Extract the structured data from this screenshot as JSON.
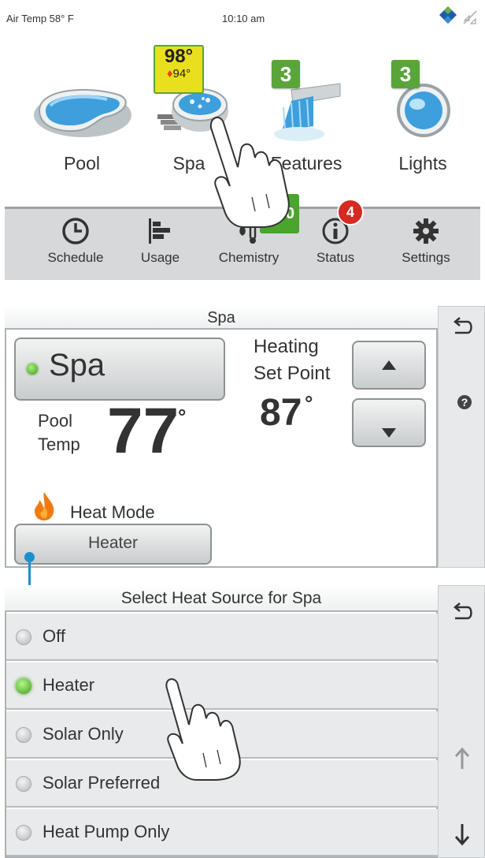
{
  "status_bar": {
    "air_temp": "Air Temp 58° F",
    "time": "10:10 am"
  },
  "tiles": [
    {
      "label": "Pool"
    },
    {
      "label": "Spa",
      "temp": "98°",
      "set": "94°"
    },
    {
      "label": "Features",
      "badge": "3"
    },
    {
      "label": "Lights",
      "badge": "3"
    }
  ],
  "nav": [
    {
      "label": "Schedule",
      "icon": "clock-icon"
    },
    {
      "label": "Usage",
      "icon": "bar-chart-icon"
    },
    {
      "label": "Chemistry",
      "icon": "drop-thermometer-icon",
      "badge": "0"
    },
    {
      "label": "Status",
      "icon": "info-icon",
      "badge": "4"
    },
    {
      "label": "Settings",
      "icon": "gear-icon"
    }
  ],
  "spa_panel": {
    "title": "Spa",
    "spa_button": "Spa",
    "heating_line1": "Heating",
    "heating_line2": "Set Point",
    "set_point": "87",
    "pool_line1": "Pool",
    "pool_line2": "Temp",
    "pool_temp": "77",
    "degree": "°",
    "heat_mode_label": "Heat Mode",
    "heat_mode_value": "Heater"
  },
  "heat_source": {
    "title": "Select Heat Source for Spa",
    "options": [
      {
        "label": "Off",
        "selected": false
      },
      {
        "label": "Heater",
        "selected": true
      },
      {
        "label": "Solar Only",
        "selected": false
      },
      {
        "label": "Solar Preferred",
        "selected": false
      },
      {
        "label": "Heat Pump Only",
        "selected": false
      }
    ]
  },
  "colors": {
    "accent_green": "#5aa53a",
    "alert_red": "#d42a22",
    "connector_blue": "#1d8fcf",
    "spa_badge_yellow": "#eadf1c"
  }
}
